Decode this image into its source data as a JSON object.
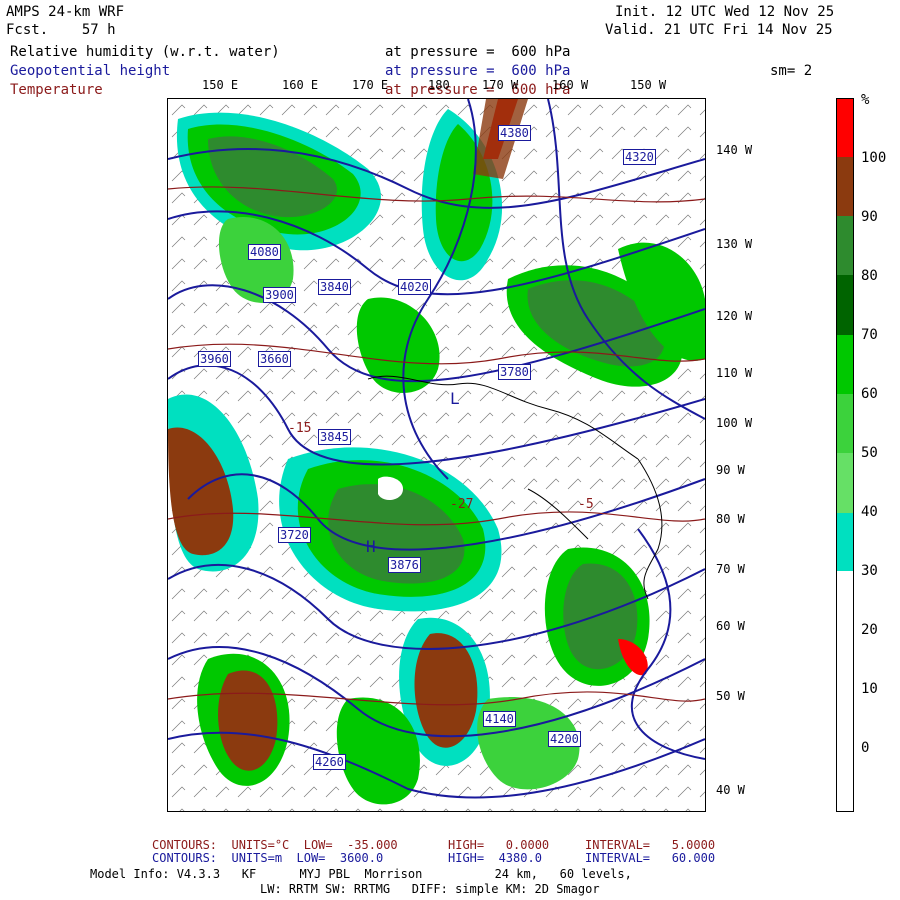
{
  "header": {
    "model": "AMPS 24-km WRF",
    "fcst": "Fcst.    57 h",
    "init": "Init. 12 UTC Wed 12 Nov 25",
    "valid": "Valid. 21 UTC Fri 14 Nov 25",
    "smoothing": "sm= 2"
  },
  "fields": [
    {
      "name": "Relative humidity (w.r.t. water)",
      "level": "at pressure =  600 hPa",
      "color": "#000000"
    },
    {
      "name": "Geopotential height",
      "level": "at pressure =  600 hPa",
      "color": "#1a1a9c"
    },
    {
      "name": "Temperature",
      "level": "at pressure =  600 hPa",
      "color": "#8b1a1a"
    }
  ],
  "map": {
    "top_longitudes": [
      "150 E",
      "160 E",
      "170 E",
      "180",
      "170 W",
      "160 W",
      "150 W"
    ],
    "right_longitudes": [
      "140 W",
      "130 W",
      "120 W",
      "110 W",
      "100 W",
      "90 W",
      "80 W",
      "70 W",
      "60 W",
      "50 W",
      "40 W"
    ],
    "height_labels": [
      "4380",
      "4320",
      "4260",
      "4200",
      "4140",
      "4080",
      "4020",
      "3960",
      "3900",
      "3840",
      "3780",
      "3720",
      "3660",
      "3876",
      "3845"
    ],
    "temp_labels": [
      "-15",
      "-27",
      "-5"
    ],
    "center_marks": [
      "H",
      "L"
    ]
  },
  "colorbar": {
    "unit": "%",
    "labels": [
      "100",
      "90",
      "80",
      "70",
      "60",
      "50",
      "40",
      "30",
      "20",
      "10",
      "0"
    ],
    "colors": [
      "#ff0000",
      "#8b3a0f",
      "#2e8b2e",
      "#006400",
      "#00c800",
      "#3cd23c",
      "#66e066",
      "#00e0c0",
      "#ffffff",
      "#ffffff",
      "#ffffff"
    ]
  },
  "footer": {
    "temp_contours": {
      "label": "CONTOURS:  UNITS=°C  LOW=  -35.000",
      "high": "HIGH=   0.0000",
      "interval": "INTERVAL=   5.0000"
    },
    "height_contours": {
      "label": "CONTOURS:  UNITS=m  LOW=  3600.0",
      "high": "HIGH=  4380.0",
      "interval": "INTERVAL=   60.000"
    },
    "model_info": "Model Info: V4.3.3   KF      MYJ PBL  Morrison          24 km,   60 levels,",
    "physics": "LW: RRTM SW: RRTMG   DIFF: simple KM: 2D Smagor"
  }
}
